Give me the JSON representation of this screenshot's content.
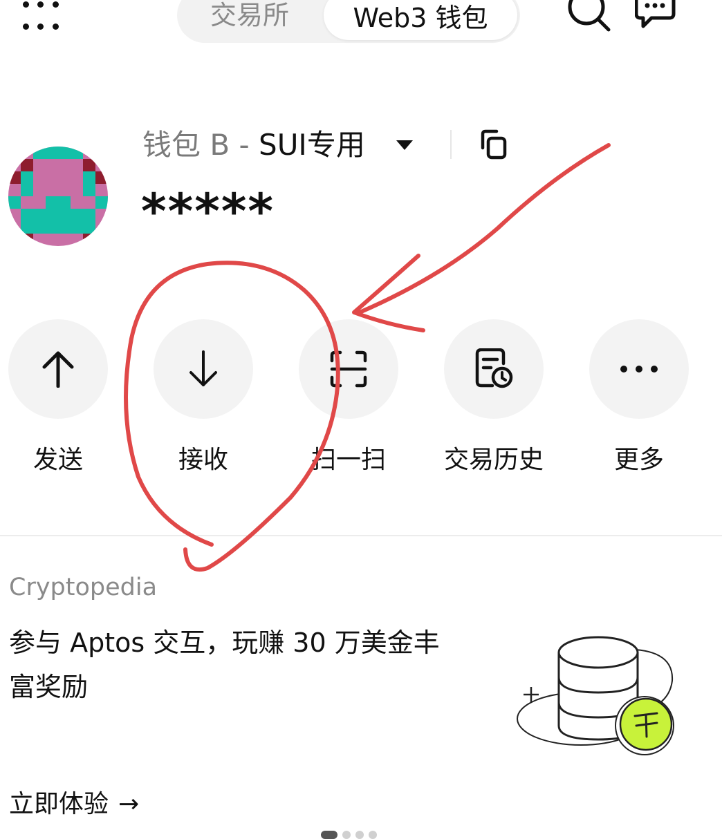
{
  "header": {
    "tabs": [
      {
        "label": "交易所",
        "active": false
      },
      {
        "label": "Web3 钱包",
        "active": true
      }
    ],
    "icons": [
      "menu-grid-icon",
      "search-icon",
      "message-icon"
    ]
  },
  "wallet": {
    "name_prefix": "钱包 B - ",
    "name_suffix": "SUI专用",
    "balance": "*****"
  },
  "actions": [
    {
      "label": "发送",
      "icon": "arrow-up-icon"
    },
    {
      "label": "接收",
      "icon": "arrow-down-icon"
    },
    {
      "label": "扫一扫",
      "icon": "scan-icon"
    },
    {
      "label": "交易历史",
      "icon": "history-icon"
    },
    {
      "label": "更多",
      "icon": "more-icon"
    }
  ],
  "promo": {
    "tag": "Cryptopedia",
    "title": "参与 Aptos 交互，玩赚 30 万美金丰富奖励",
    "cta": "立即体验",
    "cta_arrow": "→",
    "page_count": 4,
    "active_page": 1
  },
  "colors": {
    "annotation": "#e04848",
    "accent_green": "#c8f23a",
    "avatar_pink": "#c96fa5",
    "avatar_teal": "#13c0a8",
    "avatar_dark": "#8e1d2e"
  }
}
